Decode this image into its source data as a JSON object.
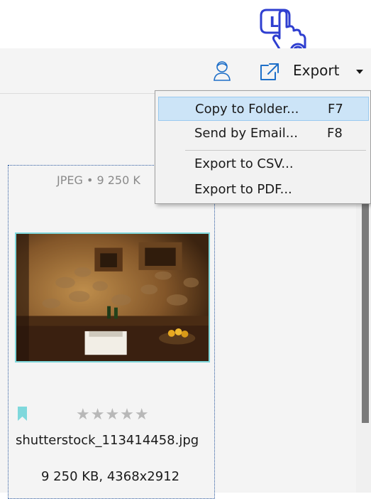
{
  "toolbar": {
    "export_label": "Export"
  },
  "export_menu": {
    "items": [
      {
        "label": "Copy to Folder...",
        "shortcut": "F7",
        "highlighted": true
      },
      {
        "label": "Send by Email...",
        "shortcut": "F8",
        "highlighted": false
      },
      {
        "label": "Export to CSV...",
        "shortcut": "",
        "highlighted": false
      },
      {
        "label": "Export to PDF...",
        "shortcut": "",
        "highlighted": false
      }
    ]
  },
  "thumbnail": {
    "info": "JPEG • 9 250 K",
    "rating_stars": "★★★★★",
    "rating_value": 0,
    "file_name": "shutterstock_113414458.jpg",
    "file_meta": "9 250 KB, 4368x2912"
  },
  "tutorial_cursor": {
    "letter": "L"
  },
  "icons": {
    "tutorial": "hand-pointer-icon",
    "person": "person-icon",
    "export": "export-icon",
    "caret": "chevron-down-icon",
    "bookmark": "bookmark-icon"
  },
  "colors": {
    "toolbar_bg": "#f4f4f4",
    "menu_highlight": "#cce4f7",
    "tutorial_blue": "#2f3fd0",
    "photo_border": "#7fd8dc",
    "export_icon": "#1e6fc8",
    "bookmark": "#7fd8dc"
  }
}
